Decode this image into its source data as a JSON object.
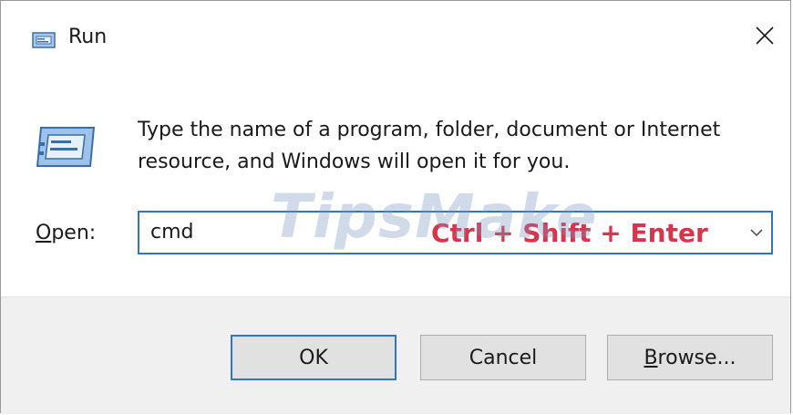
{
  "window": {
    "title": "Run",
    "title_icon": "run-icon",
    "close_icon": "close-icon"
  },
  "content": {
    "description_line1": "Type the name of a program, folder, document or Internet",
    "description_line2": "resource, and Windows will open it for you.",
    "big_icon": "run-icon",
    "open_label_first": "O",
    "open_label_rest": "pen:",
    "combo": {
      "value": "cmd",
      "overlay_hint": "Ctrl + Shift + Enter",
      "dropdown_icon": "chevron-down-icon"
    },
    "watermark": "TipsMake"
  },
  "buttons": {
    "ok": "OK",
    "cancel": "Cancel",
    "browse_first": "B",
    "browse_rest": "rowse..."
  },
  "colors": {
    "accent": "#2f74c6",
    "hint": "#d9344a",
    "footer_bg": "#f0f0f0",
    "button_bg": "#e1e1e1"
  }
}
